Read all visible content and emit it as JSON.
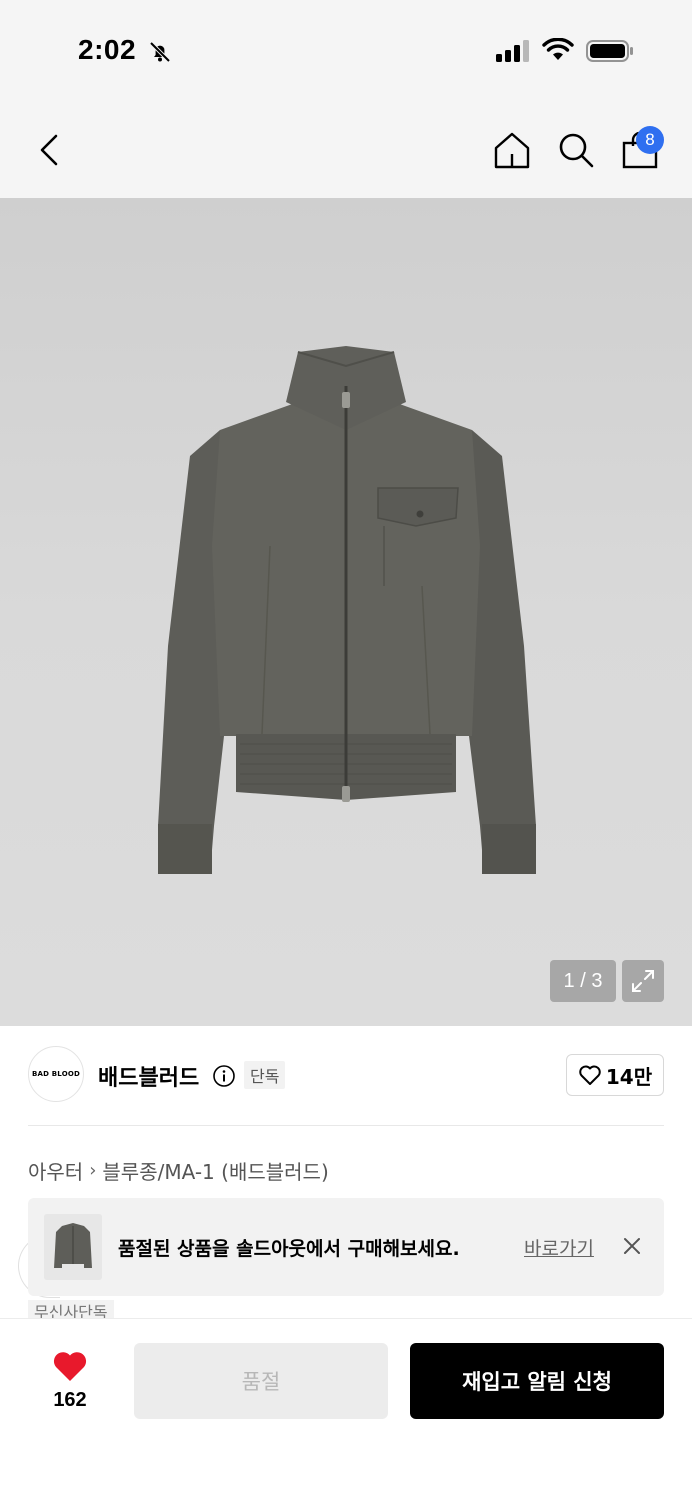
{
  "status": {
    "time": "2:02",
    "icons": [
      "bell-off-icon",
      "signal-icon",
      "wifi-icon",
      "battery-icon"
    ]
  },
  "nav": {
    "back_icon": "chevron-left-icon",
    "home_icon": "home-icon",
    "search_icon": "search-icon",
    "bag_icon": "shopping-bag-icon",
    "cart_count": "8",
    "badge_color": "#2f6ff0"
  },
  "gallery": {
    "page_indicator": "1 / 3",
    "expand_icon": "expand-icon"
  },
  "brand": {
    "logo_text": "BAD BLOOD",
    "name": "배드블러드",
    "exclusive_tag": "단독",
    "like_count": "14만"
  },
  "breadcrumb": {
    "items": [
      "아우터",
      "블루종/MA-1 (배드블러드)"
    ]
  },
  "banner": {
    "text": "품절된 상품을 솔드아웃에서 구매해보세요.",
    "link": "바로가기"
  },
  "partial_tag": "무신사단독",
  "bottom": {
    "heart_count": "162",
    "heart_color": "#e8192c",
    "soldout_label": "품절",
    "restock_label": "재입고 알림 신청"
  }
}
